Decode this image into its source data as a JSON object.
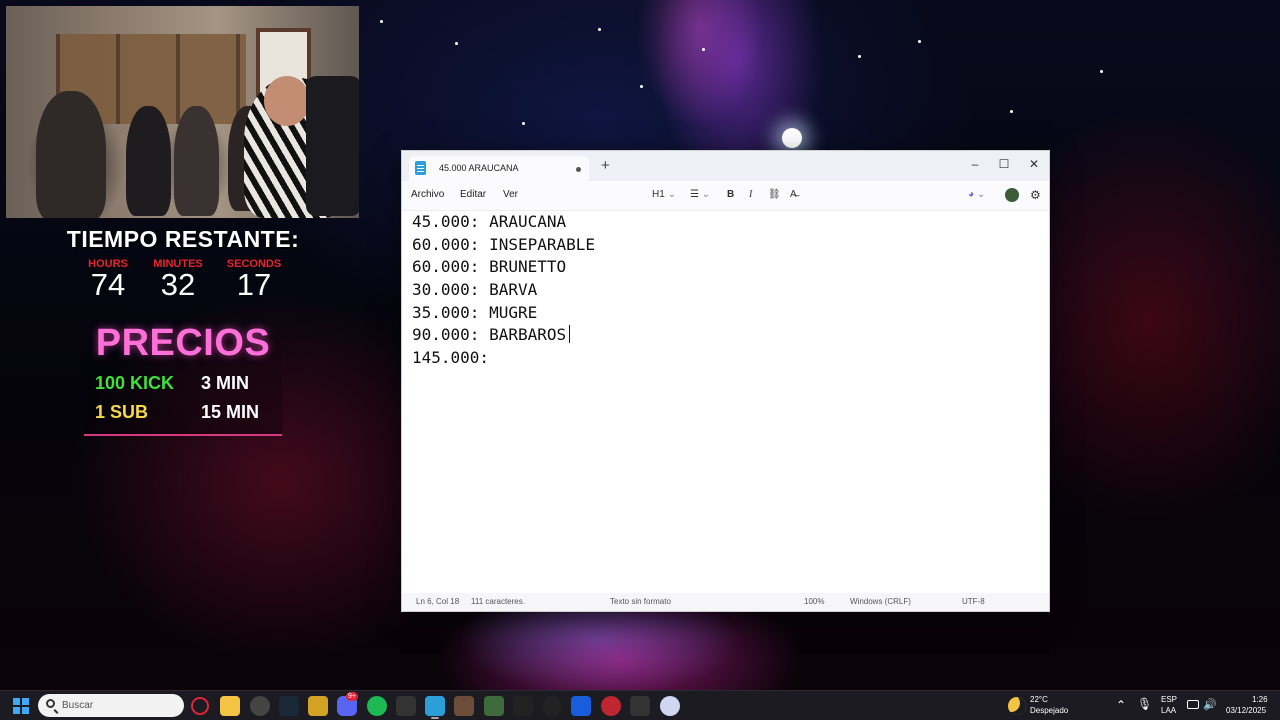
{
  "overlay": {
    "title": "TIEMPO RESTANTE:",
    "timer": [
      {
        "label": "HOURS",
        "value": "74"
      },
      {
        "label": "MINUTES",
        "value": "32"
      },
      {
        "label": "SECONDS",
        "value": "17"
      }
    ],
    "precios_title": "PRECIOS",
    "prices": [
      {
        "item": "100 KICK",
        "time": "3 MIN",
        "color": "#3fe03a"
      },
      {
        "item": "1 SUB",
        "time": "15 MIN",
        "color": "#f6d84a"
      }
    ]
  },
  "notepad": {
    "tab_title": "45.000 ARAUCANA",
    "new_tab": "+",
    "window_controls": {
      "minimize": "–",
      "maximize": "☐",
      "close": "✕"
    },
    "menu": [
      "Archivo",
      "Editar",
      "Ver"
    ],
    "toolbar": {
      "heading": "H1",
      "list": "☰",
      "bold": "B",
      "italic": "I",
      "link": "⛓",
      "clear_format": "A̶",
      "copilot": "◕",
      "settings": "⚙"
    },
    "lines": [
      "45.000: ARAUCANA",
      "60.000: INSEPARABLE",
      "60.000: BRUNETTO",
      "30.000: BARVA",
      "35.000: MUGRE",
      "90.000: BARBAROS",
      "145.000:"
    ],
    "status": {
      "position": "Ln 6, Col 18",
      "chars": "111 caracteres.",
      "format": "Texto sin formato",
      "zoom": "100%",
      "line_endings": "Windows (CRLF)",
      "encoding": "UTF-8"
    }
  },
  "taskbar": {
    "search_placeholder": "Buscar",
    "discord_badge": "9+",
    "weather": {
      "temp": "22°C",
      "desc": "Despejado"
    },
    "lang": {
      "line1": "ESP",
      "line2": "LAA"
    },
    "time": "1:26",
    "date": "03/12/2025"
  }
}
